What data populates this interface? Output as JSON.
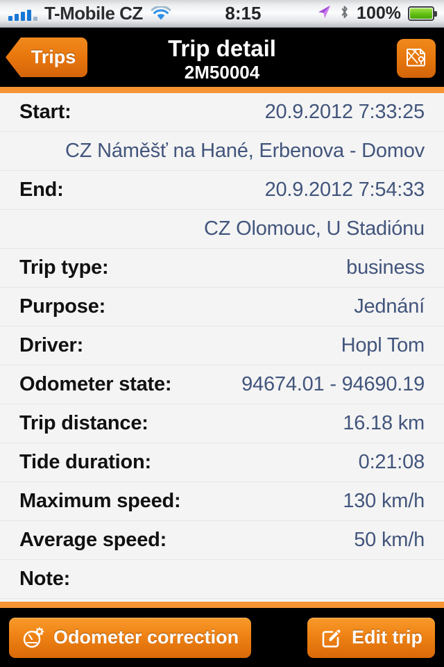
{
  "statusbar": {
    "signal_icon": "signal-bars-icon",
    "carrier": "T-Mobile CZ",
    "wifi_icon": "wifi-icon",
    "time": "8:15",
    "location_icon": "location-arrow-icon",
    "bluetooth_icon": "bluetooth-icon",
    "battery_percent": "100%",
    "battery_icon": "battery-full-icon"
  },
  "navbar": {
    "back_label": "Trips",
    "title": "Trip detail",
    "subtitle": "2M50004",
    "map_button_icon": "map-pin-icon"
  },
  "colors": {
    "accent_orange": "#f79434",
    "button_orange": "#ef8215",
    "value_blue": "#42557c",
    "list_background": "#f4f4f4",
    "bar_black": "#000000"
  },
  "detail_rows": [
    {
      "label": "Start:",
      "value": "20.9.2012 7:33:25",
      "full_width": false
    },
    {
      "label": "",
      "value": "CZ Náměšť na Hané, Erbenova - Domov",
      "full_width": true
    },
    {
      "label": "End:",
      "value": "20.9.2012 7:54:33",
      "full_width": false
    },
    {
      "label": "",
      "value": "CZ Olomouc, U Stadiónu",
      "full_width": true
    },
    {
      "label": "Trip type:",
      "value": "business",
      "full_width": false
    },
    {
      "label": "Purpose:",
      "value": "Jednání",
      "full_width": false
    },
    {
      "label": "Driver:",
      "value": "Hopl Tom",
      "full_width": false
    },
    {
      "label": "Odometer state:",
      "value": "94674.01 - 94690.19",
      "full_width": false
    },
    {
      "label": "Trip distance:",
      "value": "16.18 km",
      "full_width": false
    },
    {
      "label": "Tide duration:",
      "value": "0:21:08",
      "full_width": false
    },
    {
      "label": "Maximum speed:",
      "value": "130 km/h",
      "full_width": false
    },
    {
      "label": "Average speed:",
      "value": "50 km/h",
      "full_width": false
    },
    {
      "label": "Note:",
      "value": "",
      "full_width": false
    }
  ],
  "toolbar": {
    "odometer_label": "Odometer correction",
    "odometer_icon": "gauge-gear-icon",
    "edit_label": "Edit trip",
    "edit_icon": "pencil-square-icon"
  }
}
